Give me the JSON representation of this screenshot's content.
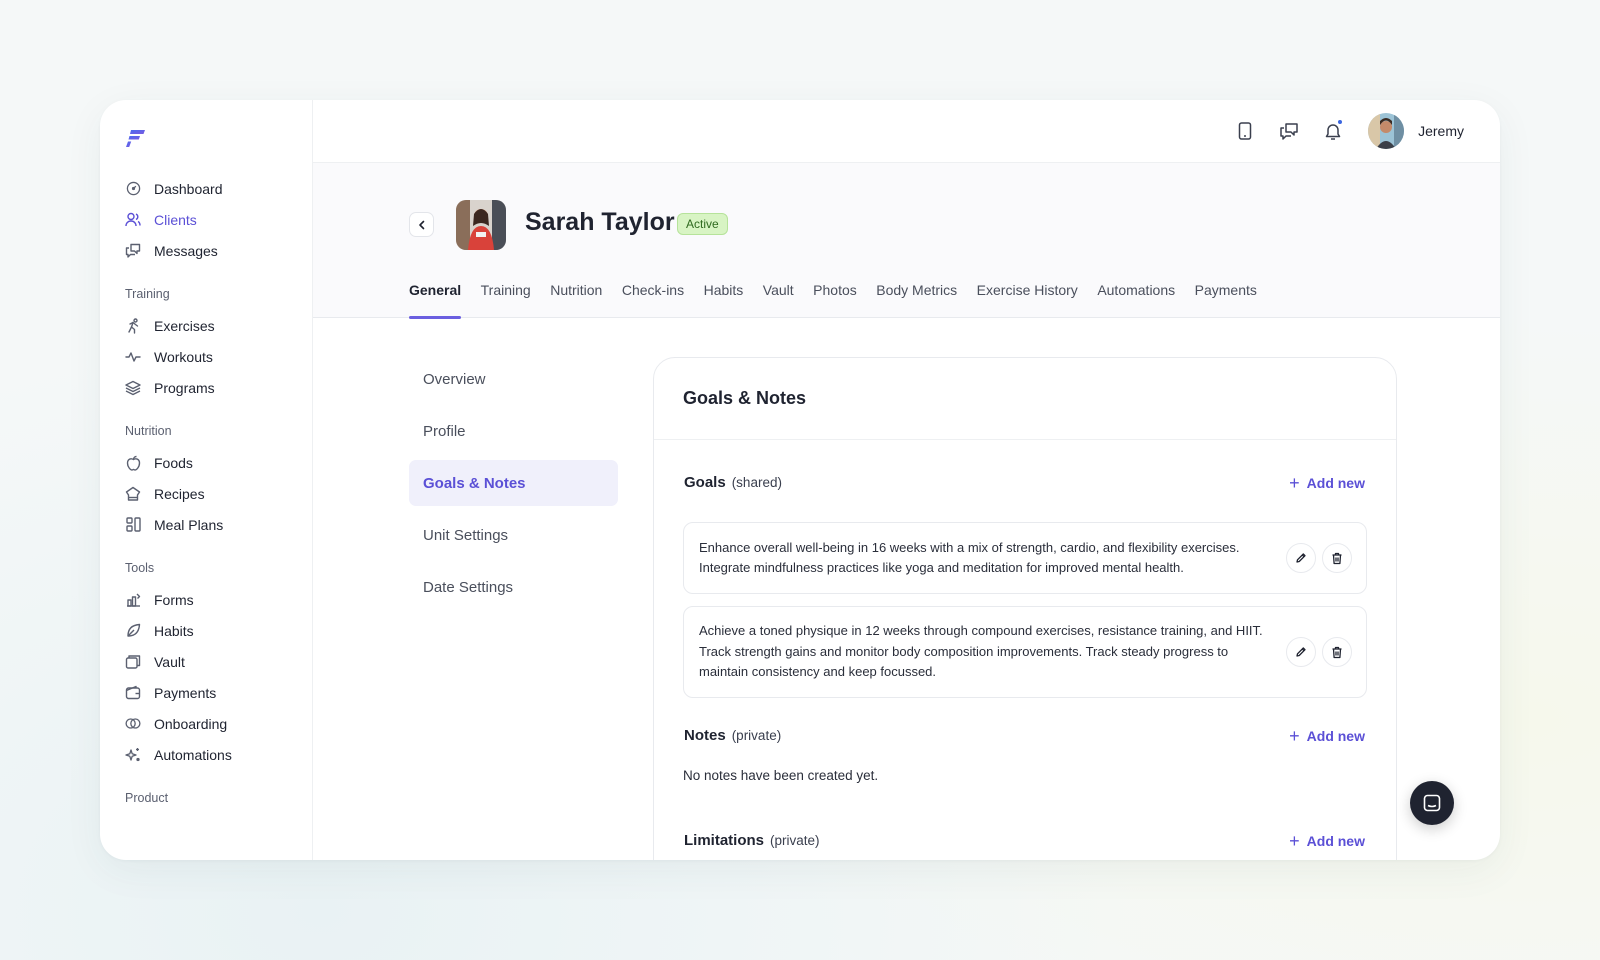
{
  "sidebar": {
    "items_top": [
      {
        "label": "Dashboard",
        "icon": "dashboard-icon"
      },
      {
        "label": "Clients",
        "icon": "users-icon",
        "active": true
      },
      {
        "label": "Messages",
        "icon": "messages-icon"
      }
    ],
    "groups": [
      {
        "title": "Training",
        "items": [
          {
            "label": "Exercises",
            "icon": "running-icon"
          },
          {
            "label": "Workouts",
            "icon": "activity-icon"
          },
          {
            "label": "Programs",
            "icon": "layers-icon"
          }
        ]
      },
      {
        "title": "Nutrition",
        "items": [
          {
            "label": "Foods",
            "icon": "apple-icon"
          },
          {
            "label": "Recipes",
            "icon": "chef-hat-icon"
          },
          {
            "label": "Meal Plans",
            "icon": "meal-plan-icon"
          }
        ]
      },
      {
        "title": "Tools",
        "items": [
          {
            "label": "Forms",
            "icon": "forms-icon"
          },
          {
            "label": "Habits",
            "icon": "leaf-icon"
          },
          {
            "label": "Vault",
            "icon": "vault-icon"
          },
          {
            "label": "Payments",
            "icon": "wallet-icon"
          },
          {
            "label": "Onboarding",
            "icon": "onboarding-icon"
          },
          {
            "label": "Automations",
            "icon": "sparkle-icon"
          }
        ]
      },
      {
        "title": "Product",
        "items": []
      }
    ]
  },
  "topbar": {
    "user_name": "Jeremy"
  },
  "client": {
    "name": "Sarah Taylor",
    "status": "Active"
  },
  "tabs": [
    "General",
    "Training",
    "Nutrition",
    "Check-ins",
    "Habits",
    "Vault",
    "Photos",
    "Body Metrics",
    "Exercise History",
    "Automations",
    "Payments"
  ],
  "active_tab": "General",
  "subnav": [
    "Overview",
    "Profile",
    "Goals & Notes",
    "Unit Settings",
    "Date Settings"
  ],
  "active_subnav": "Goals & Notes",
  "card": {
    "title": "Goals & Notes",
    "goals": {
      "title": "Goals",
      "sub": "(shared)",
      "add_label": "Add new",
      "items": [
        "Enhance overall well-being in 16 weeks with a mix of strength, cardio, and flexibility exercises. Integrate mindfulness practices like yoga and meditation for improved mental health.",
        "Achieve a toned physique in 12 weeks through compound exercises, resistance training, and HIIT. Track strength gains and monitor body composition improvements. Track steady progress to maintain consistency and keep focussed."
      ]
    },
    "notes": {
      "title": "Notes",
      "sub": "(private)",
      "add_label": "Add new",
      "empty": "No notes have been created yet."
    },
    "limitations": {
      "title": "Limitations",
      "sub": "(private)",
      "add_label": "Add new"
    }
  },
  "colors": {
    "accent": "#5b50d6",
    "status_bg": "#d8f4c4",
    "status_text": "#2f6a1f"
  }
}
